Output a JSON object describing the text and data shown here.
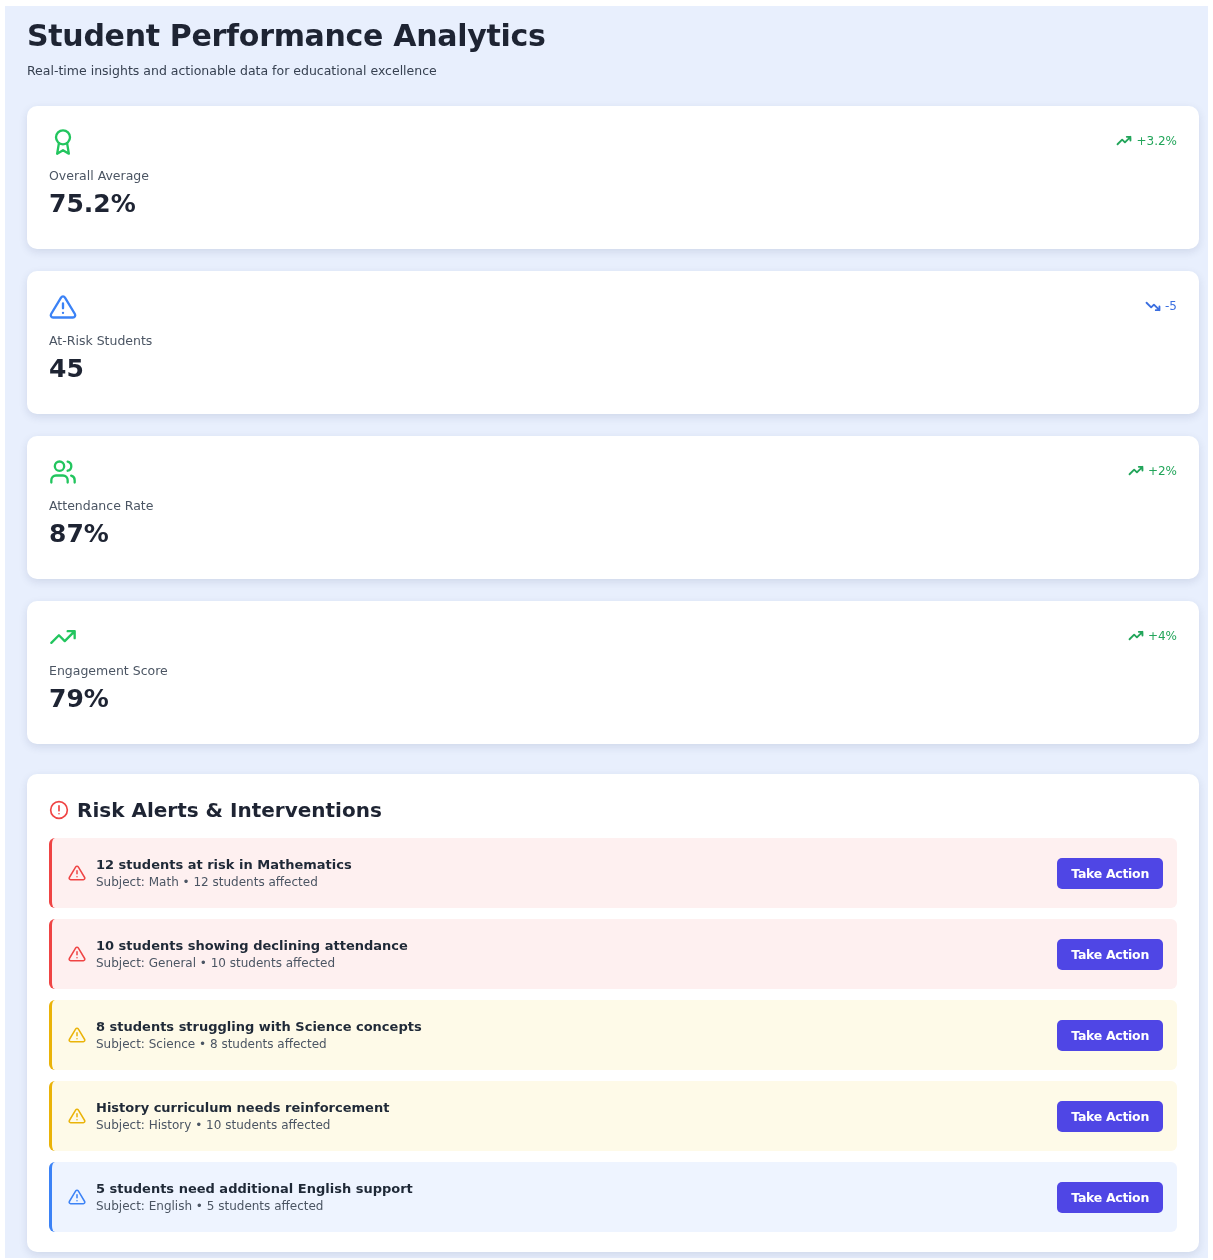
{
  "header": {
    "title": "Student Performance Analytics",
    "subtitle": "Real-time insights and actionable data for educational excellence"
  },
  "metrics": [
    {
      "kind": "award",
      "label": "Overall Average",
      "value": "75.2%",
      "change": {
        "kind": "up",
        "text": "+3.2%"
      }
    },
    {
      "kind": "warning",
      "label": "At-Risk Students",
      "value": "45",
      "change": {
        "kind": "down",
        "text": "-5"
      }
    },
    {
      "kind": "people",
      "label": "Attendance Rate",
      "value": "87%",
      "change": {
        "kind": "up",
        "text": "+2%"
      }
    },
    {
      "kind": "trend",
      "label": "Engagement Score",
      "value": "79%",
      "change": {
        "kind": "up",
        "text": "+4%"
      }
    }
  ],
  "alerts_panel": {
    "title": "Risk Alerts & Interventions",
    "alerts": [
      {
        "kind": "high",
        "title": "12 students at risk in Mathematics",
        "detail": "Subject: Math • 12 students affected",
        "action": "Take Action"
      },
      {
        "kind": "high",
        "title": "10 students showing declining attendance",
        "detail": "Subject: General • 10 students affected",
        "action": "Take Action"
      },
      {
        "kind": "medium",
        "title": "8 students struggling with Science concepts",
        "detail": "Subject: Science • 8 students affected",
        "action": "Take Action"
      },
      {
        "kind": "medium",
        "title": "History curriculum needs reinforcement",
        "detail": "Subject: History • 10 students affected",
        "action": "Take Action"
      },
      {
        "kind": "low",
        "title": "5 students need additional English support",
        "detail": "Subject: English • 5 students affected",
        "action": "Take Action"
      }
    ]
  }
}
